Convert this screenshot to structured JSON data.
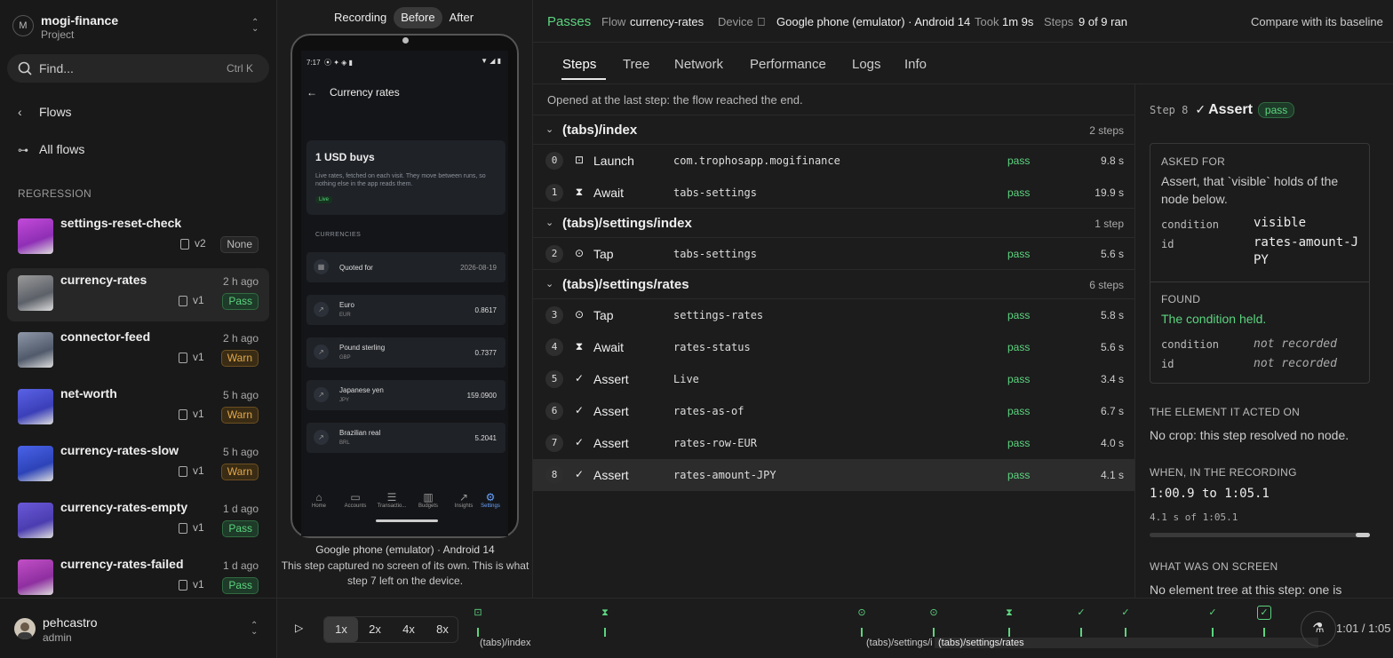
{
  "sidebar": {
    "project": {
      "avatar": "M",
      "name": "mogi-finance",
      "sub": "Project"
    },
    "search": {
      "placeholder": "Find...",
      "shortcut": "Ctrl K"
    },
    "nav": {
      "back": "Flows",
      "all": "All flows"
    },
    "section": "REGRESSION",
    "flows": [
      {
        "name": "settings-reset-check",
        "time": "",
        "ver": "v2",
        "status": "None",
        "kind": "none",
        "thumb": [
          "#c34ad8",
          "#8f2fb6"
        ]
      },
      {
        "name": "currency-rates",
        "time": "2 h ago",
        "ver": "v1",
        "status": "Pass",
        "kind": "pass",
        "thumb": [
          "#9a9a9a",
          "#5c6068"
        ]
      },
      {
        "name": "connector-feed",
        "time": "2 h ago",
        "ver": "v1",
        "status": "Warn",
        "kind": "warn",
        "thumb": [
          "#8f98a8",
          "#505a6b"
        ]
      },
      {
        "name": "net-worth",
        "time": "5 h ago",
        "ver": "v1",
        "status": "Warn",
        "kind": "warn",
        "thumb": [
          "#5a62e6",
          "#3b3fb8"
        ]
      },
      {
        "name": "currency-rates-slow",
        "time": "5 h ago",
        "ver": "v1",
        "status": "Warn",
        "kind": "warn",
        "thumb": [
          "#4a63e8",
          "#2c43b8"
        ]
      },
      {
        "name": "currency-rates-empty",
        "time": "1 d ago",
        "ver": "v1",
        "status": "Pass",
        "kind": "pass",
        "thumb": [
          "#6a59d8",
          "#4b3db0"
        ]
      },
      {
        "name": "currency-rates-failed",
        "time": "1 d ago",
        "ver": "v1",
        "status": "Pass",
        "kind": "pass",
        "thumb": [
          "#c24fc6",
          "#8e2fa0"
        ]
      }
    ],
    "user": {
      "name": "pehcastro",
      "role": "admin"
    }
  },
  "device": {
    "toggle": [
      "Recording",
      "Before",
      "After"
    ],
    "active_toggle": "Before",
    "phone": {
      "time": "7:17",
      "title": "Currency rates",
      "card_title": "1 USD buys",
      "card_desc": "Live rates, fetched on each visit. They move between runs, so nothing else in the app reads them.",
      "live": "Live",
      "currencies_label": "CURRENCIES",
      "quoted_label": "Quoted for",
      "quoted_date": "2026-08-19",
      "rates": [
        {
          "name": "Euro",
          "code": "EUR",
          "value": "0.8617"
        },
        {
          "name": "Pound sterling",
          "code": "GBP",
          "value": "0.7377"
        },
        {
          "name": "Japanese yen",
          "code": "JPY",
          "value": "159.0900"
        },
        {
          "name": "Brazilian real",
          "code": "BRL",
          "value": "5.2041"
        }
      ],
      "nav": [
        "Home",
        "Accounts",
        "Transactio...",
        "Budgets",
        "Insights",
        "Settings"
      ]
    },
    "caption": "Google phone (emulator) · Android 14",
    "note": "This step captured no screen of its own. This is what step 7 left on the device."
  },
  "topbar": {
    "status": "Passes",
    "flow_label": "Flow",
    "flow": "currency-rates",
    "device_label": "Device",
    "device": "Google phone (emulator) · Android 14",
    "took_label": "Took",
    "took": "1m 9s",
    "steps_label": "Steps",
    "steps": "9 of 9 ran",
    "compare": "Compare with its baseline",
    "accent": "#5cd47f"
  },
  "tabs": [
    "Steps",
    "Tree",
    "Network",
    "Performance",
    "Logs",
    "Info"
  ],
  "steps_panel": {
    "opened": "Opened at the last step: the flow reached the end.",
    "groups": [
      {
        "name": "(tabs)/index",
        "count": "2 steps"
      },
      {
        "name": "(tabs)/settings/index",
        "count": "1 step"
      },
      {
        "name": "(tabs)/settings/rates",
        "count": "6 steps"
      }
    ],
    "steps": [
      {
        "n": "0",
        "icon": "launch-icon",
        "action": "Launch",
        "target": "com.trophosapp.mogifinance",
        "status": "pass",
        "dur": "9.8 s"
      },
      {
        "n": "1",
        "icon": "hourglass-icon",
        "action": "Await",
        "target": "tabs-settings",
        "status": "pass",
        "dur": "19.9 s"
      },
      {
        "n": "2",
        "icon": "tap-icon",
        "action": "Tap",
        "target": "tabs-settings",
        "status": "pass",
        "dur": "5.6 s"
      },
      {
        "n": "3",
        "icon": "tap-icon",
        "action": "Tap",
        "target": "settings-rates",
        "status": "pass",
        "dur": "5.8 s"
      },
      {
        "n": "4",
        "icon": "hourglass-icon",
        "action": "Await",
        "target": "rates-status",
        "status": "pass",
        "dur": "5.6 s"
      },
      {
        "n": "5",
        "icon": "check-icon",
        "action": "Assert",
        "target": "Live",
        "status": "pass",
        "dur": "3.4 s"
      },
      {
        "n": "6",
        "icon": "check-icon",
        "action": "Assert",
        "target": "rates-as-of",
        "status": "pass",
        "dur": "6.7 s"
      },
      {
        "n": "7",
        "icon": "check-icon",
        "action": "Assert",
        "target": "rates-row-EUR",
        "status": "pass",
        "dur": "4.0 s"
      },
      {
        "n": "8",
        "icon": "check-icon",
        "action": "Assert",
        "target": "rates-amount-JPY",
        "status": "pass",
        "dur": "4.1 s"
      }
    ]
  },
  "detail": {
    "step": "Step 8",
    "action": "Assert",
    "status": "pass",
    "asked_label": "ASKED FOR",
    "asked": "Assert, that `visible` holds of the node below.",
    "cond_key": "condition",
    "cond_val": "visible",
    "id_key": "id",
    "id_val": "rates-amount-JPY",
    "found_label": "FOUND",
    "found": "The condition held.",
    "found_cond_key": "condition",
    "found_cond": "not recorded",
    "found_id_key": "id",
    "found_id": "not recorded",
    "element_label": "THE ELEMENT IT ACTED ON",
    "element": "No crop: this step resolved no node.",
    "when_label": "WHEN, IN THE RECORDING",
    "range": "1:00.9 to 1:05.1",
    "range_sub": "4.1 s of 1:05.1",
    "screen_label": "WHAT WAS ON SCREEN",
    "screen": "No element tree at this step: one is"
  },
  "timeline": {
    "speeds": [
      "1x",
      "2x",
      "4x",
      "8x"
    ],
    "active_speed": "1x",
    "groups": [
      "(tabs)/index",
      "(tabs)/settings/i",
      "(tabs)/settings/rates"
    ],
    "time": "1:01 / 1:05"
  }
}
